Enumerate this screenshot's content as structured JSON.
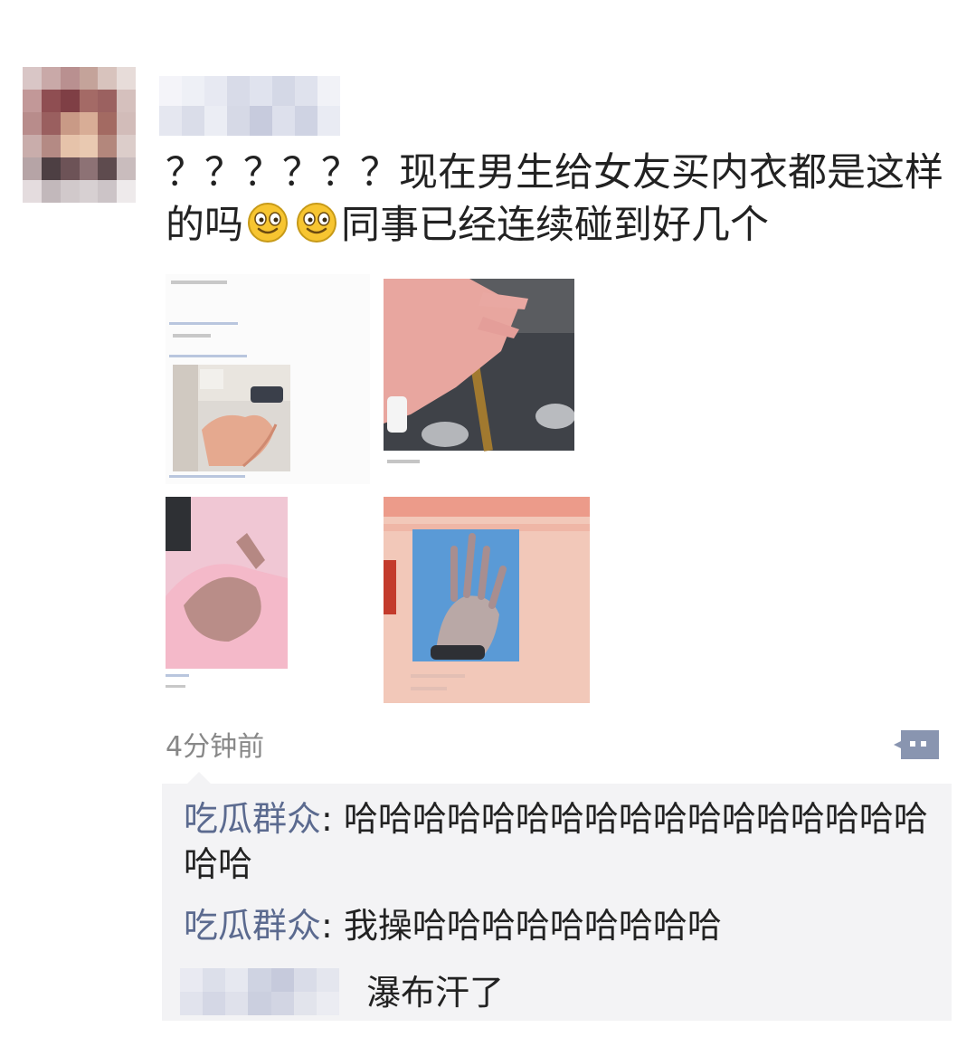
{
  "post": {
    "text_before_emoji": "？？？？？？现在男生给女友买内衣都是这样的吗",
    "text_after_emoji": "同事已经连续碰到好几个",
    "emojis": [
      "smile-emoji",
      "smile-emoji"
    ],
    "timestamp": "4分钟前",
    "images": [
      {
        "icon": "screenshot-hand-photo"
      },
      {
        "icon": "hand-photo"
      },
      {
        "icon": "hand-photo"
      },
      {
        "icon": "screenshot-hand-photo"
      }
    ]
  },
  "comments": [
    {
      "name": "吃瓜群众",
      "sep": ": ",
      "text": "哈哈哈哈哈哈哈哈哈哈哈哈哈哈哈哈哈哈哈"
    },
    {
      "name": "吃瓜群众",
      "sep": ": ",
      "text": "我操哈哈哈哈哈哈哈哈哈"
    },
    {
      "name": "",
      "sep": "",
      "text": "瀑布汗了"
    }
  ],
  "colors": {
    "name_link": "#5b6a8f",
    "comment_bg": "#f3f3f5",
    "timestamp": "#888888"
  }
}
